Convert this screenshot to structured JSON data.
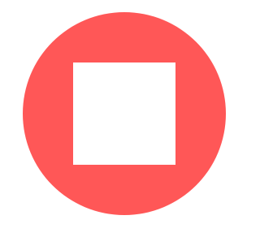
{
  "stop_control": {
    "icon": "stop-icon",
    "circle_color": "#ff5757",
    "square_color": "#ffffff"
  }
}
